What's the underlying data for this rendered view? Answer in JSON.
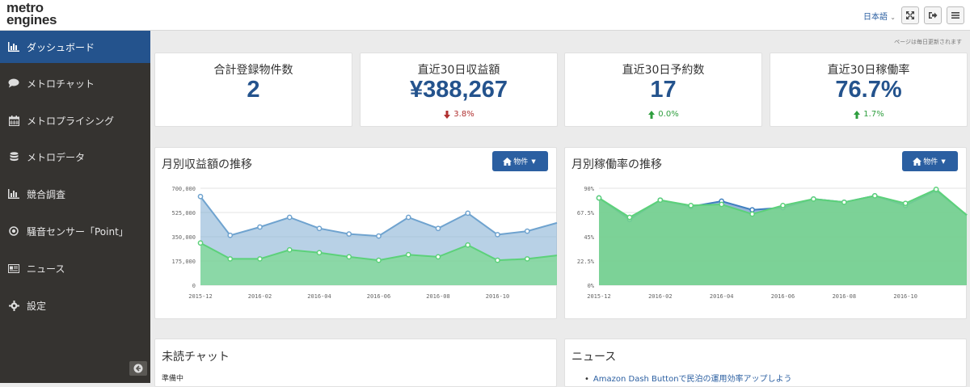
{
  "header": {
    "logo_line1": "metro",
    "logo_line2": "engines",
    "language": "日本語",
    "icons": [
      "fullscreen-icon",
      "logout-icon",
      "menu-icon"
    ]
  },
  "sidebar": {
    "items": [
      {
        "label": "ダッシュボード",
        "icon": "bar-chart-icon",
        "active": true
      },
      {
        "label": "メトロチャット",
        "icon": "chat-icon"
      },
      {
        "label": "メトロプライシング",
        "icon": "calendar-icon"
      },
      {
        "label": "メトロデータ",
        "icon": "database-icon"
      },
      {
        "label": "競合調査",
        "icon": "bar-chart-icon"
      },
      {
        "label": "騒音センサー「Point」",
        "icon": "record-icon"
      },
      {
        "label": "ニュース",
        "icon": "newspaper-icon"
      },
      {
        "label": "設定",
        "icon": "gear-icon"
      }
    ]
  },
  "update_note": "ページは毎日更新されます",
  "stats": [
    {
      "label": "合計登録物件数",
      "value": "2",
      "change": ""
    },
    {
      "label": "直近30日収益額",
      "value": "¥388,267",
      "change": "3.8%",
      "direction": "down",
      "color": "#b03030"
    },
    {
      "label": "直近30日予約数",
      "value": "17",
      "change": "0.0%",
      "direction": "up",
      "color": "#2e9e3e"
    },
    {
      "label": "直近30日稼働率",
      "value": "76.7%",
      "change": "1.7%",
      "direction": "up",
      "color": "#2e9e3e"
    }
  ],
  "property_button_label": "物件",
  "chart_data": [
    {
      "type": "area",
      "title": "月別収益額の推移",
      "x": [
        "2015-12",
        "2016-01",
        "2016-02",
        "2016-03",
        "2016-04",
        "2016-05",
        "2016-06",
        "2016-07",
        "2016-08",
        "2016-09",
        "2016-10",
        "2016-11"
      ],
      "x_tick_labels": [
        "2015-12",
        "2016-02",
        "2016-04",
        "2016-06",
        "2016-08",
        "2016-10"
      ],
      "y_tick_labels": [
        "700,000",
        "525,000",
        "350,000",
        "175,000",
        "0"
      ],
      "ylim": [
        0,
        700000
      ],
      "series": [
        {
          "values": [
            640000,
            360000,
            420000,
            490000,
            410000,
            370000,
            355000,
            490000,
            410000,
            520000,
            365000,
            390000,
            450000
          ],
          "color": "#6fa3cf"
        },
        {
          "values": [
            305000,
            190000,
            190000,
            255000,
            235000,
            205000,
            180000,
            220000,
            205000,
            290000,
            180000,
            190000,
            215000
          ],
          "color": "#5cd17a"
        }
      ],
      "x_extended": [
        "2015-12",
        "2016-01",
        "2016-02",
        "2016-03",
        "2016-04",
        "2016-05",
        "2016-06",
        "2016-07",
        "2016-08",
        "2016-09",
        "2016-10",
        "2016-11",
        "2016-12"
      ]
    },
    {
      "type": "area",
      "title": "月別稼働率の推移",
      "x_tick_labels": [
        "2015-12",
        "2016-02",
        "2016-04",
        "2016-06",
        "2016-08",
        "2016-10"
      ],
      "y_tick_labels": [
        "90%",
        "67.5%",
        "45%",
        "22.5%",
        "0%"
      ],
      "ylim": [
        0,
        90
      ],
      "series": [
        {
          "values": [
            81,
            61,
            79,
            73,
            78,
            70,
            72,
            80,
            77,
            83,
            74,
            88,
            65
          ],
          "color": "#3f7fbf"
        },
        {
          "values": [
            81,
            63,
            79,
            74,
            75,
            66,
            74,
            80,
            77,
            83,
            76,
            89,
            65
          ],
          "color": "#5cd17a"
        }
      ]
    }
  ],
  "unread_chat": {
    "title": "未読チャット",
    "status": "準備中"
  },
  "news": {
    "title": "ニュース",
    "items": [
      "Amazon Dash Buttonで民泊の運用効率アップしよう"
    ]
  }
}
